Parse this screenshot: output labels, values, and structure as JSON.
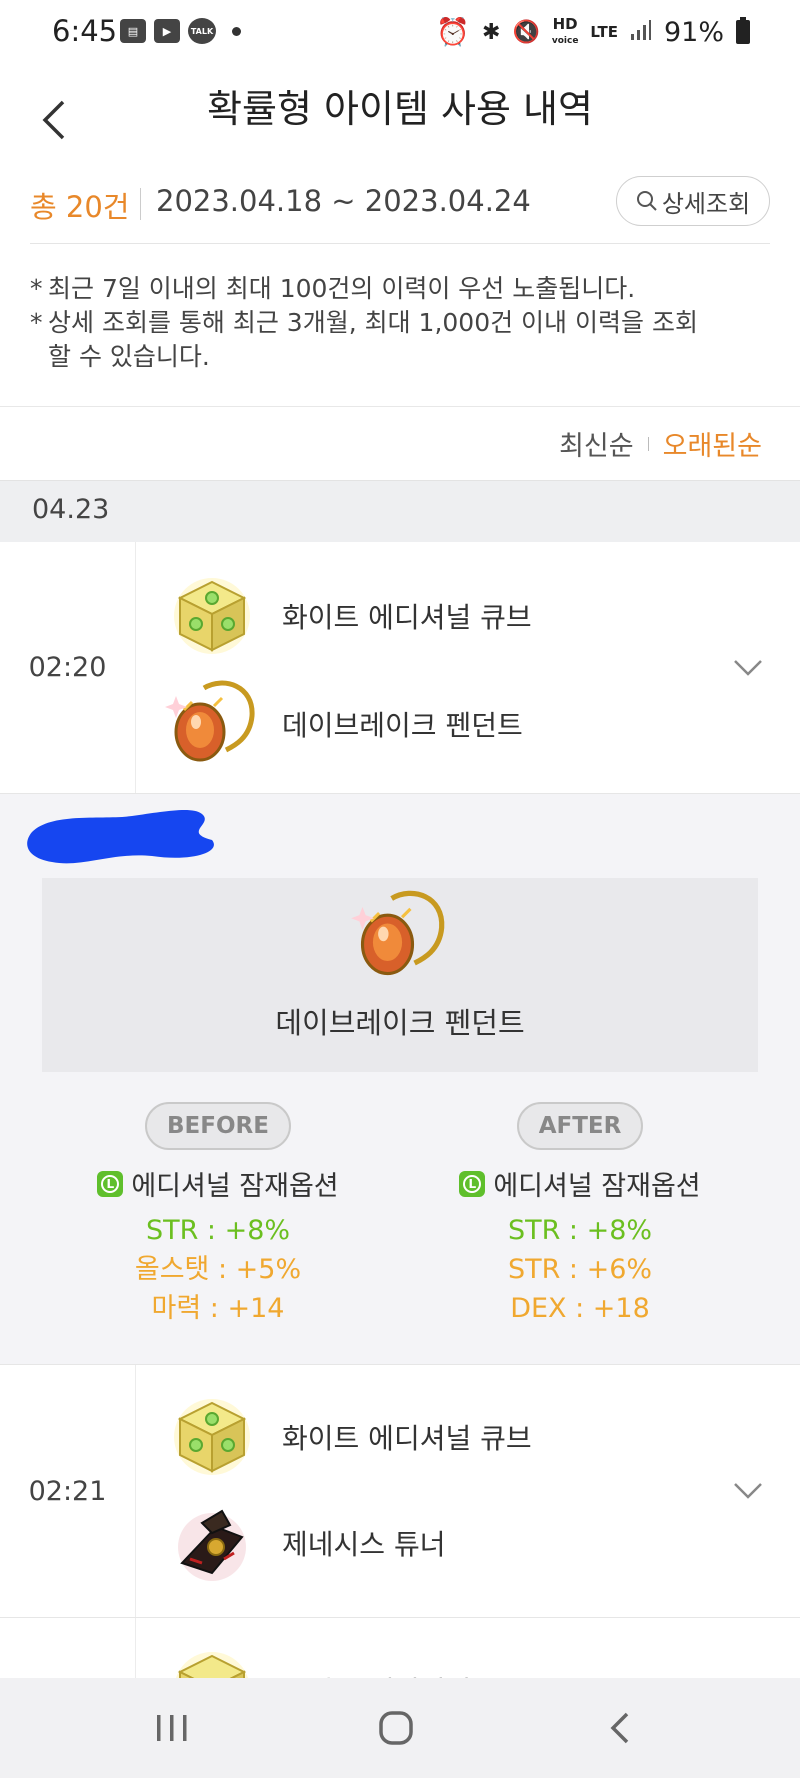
{
  "status_bar": {
    "time": "6:45",
    "left_icons": [
      "notification-icon",
      "video-call-icon",
      "talk-icon"
    ],
    "hd_label": "HD",
    "voice_label": "voice",
    "lte_label": "LTE",
    "battery": "91%"
  },
  "header": {
    "title": "확률형 아이템 사용 내역"
  },
  "summary": {
    "count": "총 20건",
    "date_range": "2023.04.18 ~ 2023.04.24",
    "detail_button": "상세조회"
  },
  "notice": {
    "line1": "최근 7일 이내의 최대 100건의 이력이 우선 노출됩니다.",
    "line2": "상세 조회를 통해 최근 3개월, 최대 1,000건 이내 이력을 조회 할 수 있습니다."
  },
  "sort": {
    "latest": "최신순",
    "oldest": "오래된순",
    "active": "오래된순"
  },
  "date_group": "04.23",
  "records": [
    {
      "time": "02:20",
      "cube": "화이트 에디셔널 큐브",
      "target": "데이브레이크 펜던트"
    },
    {
      "time": "02:21",
      "cube": "화이트 에디셔널 큐브",
      "target": "제네시스 튜너"
    },
    {
      "cube": "화이트 에디셔널 큐브"
    }
  ],
  "detail": {
    "item_name": "데이브레이크 펜던트",
    "before": {
      "label": "BEFORE",
      "option_title": "에디셔널 잠재옵션",
      "lines": [
        "STR : +8%",
        "올스탯 : +5%",
        "마력 : +14"
      ]
    },
    "after": {
      "label": "AFTER",
      "option_title": "에디셔널 잠재옵션",
      "lines": [
        "STR : +8%",
        "STR : +6%",
        "DEX : +18"
      ]
    },
    "grade_badge": "L"
  },
  "colors": {
    "accent": "#e8882a",
    "option_green": "#6bbf20",
    "option_orange": "#f0a830",
    "redaction": "#1646f0"
  }
}
